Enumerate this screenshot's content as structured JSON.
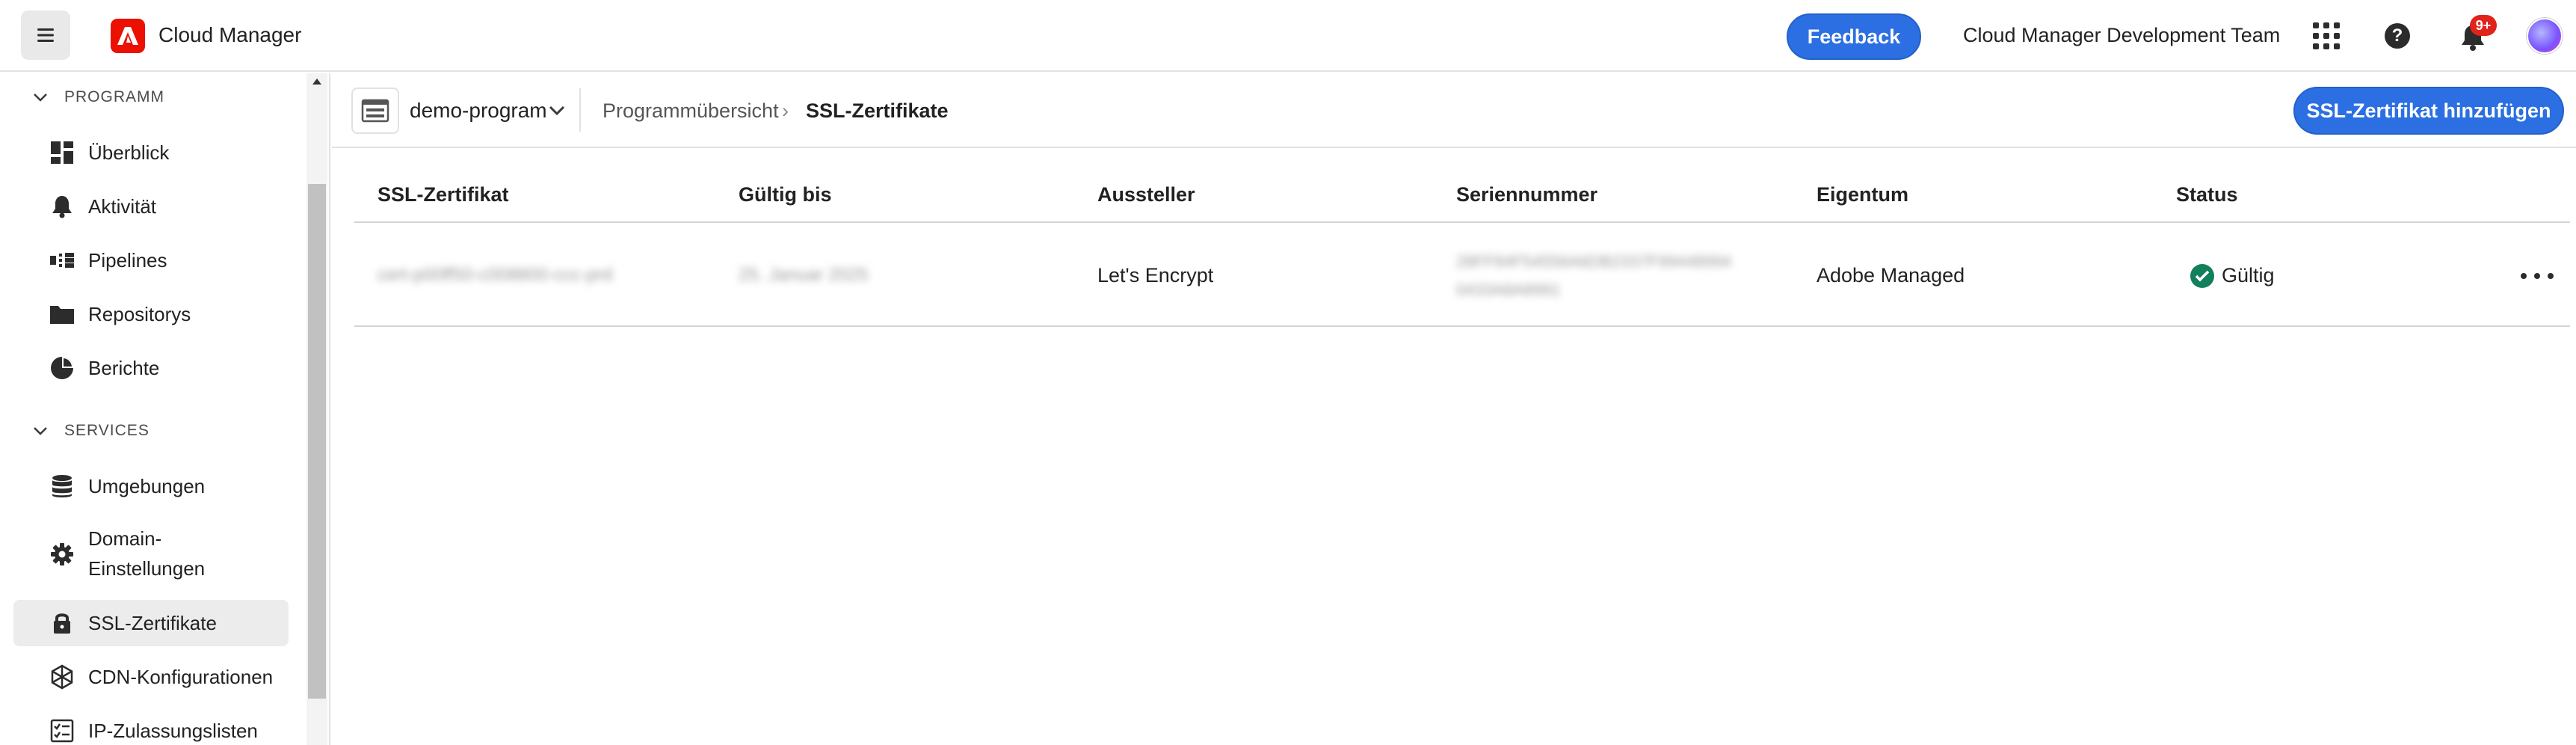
{
  "app": {
    "name": "Cloud Manager",
    "feedback_label": "Feedback",
    "org_name": "Cloud Manager Development Team",
    "notification_badge": "9+"
  },
  "sidebar": {
    "sections": [
      {
        "title": "PROGRAMM"
      },
      {
        "title": "SERVICES"
      }
    ],
    "items": [
      {
        "label": "Überblick",
        "icon": "dashboard-icon"
      },
      {
        "label": "Aktivität",
        "icon": "bell-icon"
      },
      {
        "label": "Pipelines",
        "icon": "pipeline-icon"
      },
      {
        "label": "Repositorys",
        "icon": "folder-icon"
      },
      {
        "label": "Berichte",
        "icon": "pie-chart-icon"
      },
      {
        "label": "Umgebungen",
        "icon": "database-icon"
      },
      {
        "label": "Domain-",
        "label2": "Einstellungen",
        "icon": "gear-icon"
      },
      {
        "label": "SSL-Zertifikate",
        "icon": "lock-icon",
        "active": true
      },
      {
        "label": "CDN-Konfigurationen",
        "icon": "network-icon"
      },
      {
        "label": "IP-Zulassungslisten",
        "icon": "checklist-icon"
      }
    ]
  },
  "breadcrumb": {
    "program": "demo-program",
    "items": [
      "Programmübersicht",
      "SSL-Zertifikate"
    ],
    "separator": "›"
  },
  "actions": {
    "add_certificate": "SSL-Zertifikat hinzufügen"
  },
  "table": {
    "columns": [
      "SSL-Zertifikat",
      "Gültig bis",
      "Aussteller",
      "Seriennummer",
      "Eigentum",
      "Status"
    ],
    "rows": [
      {
        "name": "cert-p00ff50-c008800-ccc-prd",
        "valid_until": "25. Januar 2025",
        "issuer": "Let's Encrypt",
        "serial_line1": "28FF84F54556A6DB2337F99448994",
        "serial_line2": "0433A8A8991",
        "ownership": "Adobe Managed",
        "status": "Gültig",
        "status_color": "#12805c"
      }
    ]
  },
  "colors": {
    "accent": "#2b6fe2",
    "brand": "#eb1000",
    "badge": "#e0241b"
  }
}
